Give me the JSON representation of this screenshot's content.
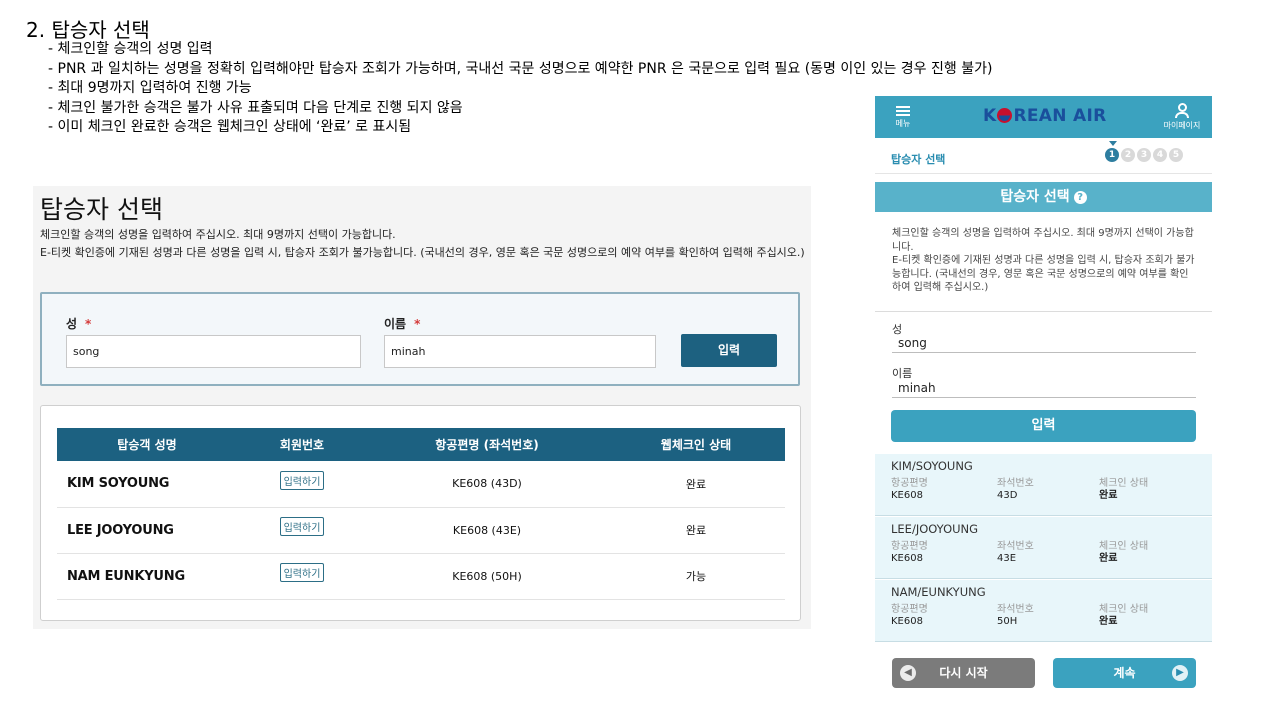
{
  "spec": {
    "title": "2. 탑승자 선택",
    "items": [
      "체크인할 승객의 성명 입력",
      "PNR 과 일치하는 성명을 정확히 입력해야만 탑승자 조회가 가능하며, 국내선 국문 성명으로 예약한 PNR 은 국문으로 입력 필요 (동명 이인 있는 경우 진행 불가)",
      "최대 9명까지 입력하여 진행 가능",
      "체크인 불가한 승객은 불가 사유 표출되며 다음 단계로 진행 되지 않음",
      "이미 체크인 완료한 승객은 웹체크인 상태에 ‘완료’ 로 표시됨"
    ]
  },
  "desktop": {
    "title": "탑승자 선택",
    "desc": "체크인할 승객의 성명을 입력하여 주십시오. 최대 9명까지 선택이 가능합니다.\nE-티켓 확인증에 기재된 성명과 다른 성명을 입력 시, 탑승자 조회가 불가능합니다. (국내선의 경우, 영문 혹은 국문 성명으로의 예약 여부를 확인하여 입력해 주십시오.)",
    "last_name_label": "성",
    "first_name_label": "이름",
    "required_mark": "*",
    "last_name_value": "song",
    "first_name_value": "minah",
    "enter_label": "입력",
    "table": {
      "headers": [
        "탑승객 성명",
        "회원번호",
        "항공편명 (좌석번호)",
        "웹체크인 상태"
      ],
      "rows": [
        {
          "name": "KIM SOYOUNG",
          "member": "입력하기",
          "flight": "KE608 (43D)",
          "status": "완료"
        },
        {
          "name": "LEE JOOYOUNG",
          "member": "입력하기",
          "flight": "KE608 (43E)",
          "status": "완료"
        },
        {
          "name": "NAM EUNKYUNG",
          "member": "입력하기",
          "flight": "KE608 (50H)",
          "status": "가능"
        }
      ]
    }
  },
  "mobile": {
    "menu_label": "메뉴",
    "brand": "KOREAN AIR",
    "mypage_label": "마이페이지",
    "step_label": "탑승자 선택",
    "steps": [
      "1",
      "2",
      "3",
      "4",
      "5"
    ],
    "bar_title": "탑승자 선택",
    "desc": "체크인할 승객의 성명을 입력하여 주십시오. 최대 9명까지 선택이 가능합니다.\nE-티켓 확인증에 기재된 성명과 다른 성명을 입력 시, 탑승자 조회가 불가능합니다. (국내선의 경우, 영문 혹은 국문 성명으로의 예약 여부를 확인하여 입력해 주십시오.)",
    "last_name_label": "성",
    "last_name_value": "song",
    "first_name_label": "이름",
    "first_name_value": "minah",
    "enter_label": "입력",
    "col_flight": "항공편명",
    "col_seat": "좌석번호",
    "col_status": "체크인 상태",
    "passengers": [
      {
        "name": "KIM/SOYOUNG",
        "flight": "KE608",
        "seat": "43D",
        "status": "완료"
      },
      {
        "name": "LEE/JOOYOUNG",
        "flight": "KE608",
        "seat": "43E",
        "status": "완료"
      },
      {
        "name": "NAM/EUNKYUNG",
        "flight": "KE608",
        "seat": "50H",
        "status": "완료"
      }
    ],
    "restart_label": "다시 시작",
    "next_label": "계속"
  }
}
